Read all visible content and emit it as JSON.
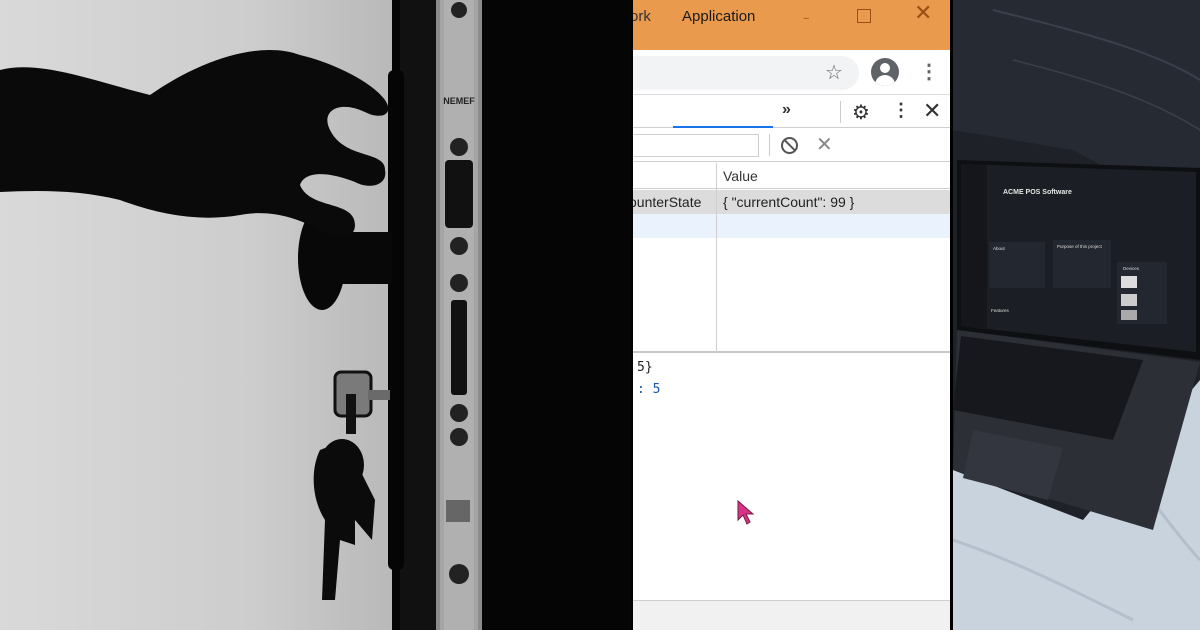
{
  "door_photo": {
    "lock_brand": "NEMEF"
  },
  "window": {
    "controls": {
      "minimize": "‒",
      "maximize": "",
      "close": "✕"
    }
  },
  "browser": {
    "star_icon": "☆",
    "menu_icon": "⋮"
  },
  "devtools": {
    "tabs": [
      {
        "label": "ork",
        "active": false
      },
      {
        "label": "Application",
        "active": true
      }
    ],
    "more_tabs": "»",
    "settings_icon": "⚙",
    "menu_icon": "⋮",
    "close_icon": "✕",
    "filter": {
      "value": ""
    },
    "delete_icon": "✕",
    "table": {
      "headers": {
        "key": "",
        "value": "Value"
      },
      "rows": [
        {
          "key": "ounterState",
          "value": "{ \"currentCount\": 99 }",
          "selected": true
        }
      ]
    },
    "preview": {
      "line1": " 5}",
      "line2": ": 5"
    }
  },
  "laptop_screen": {
    "app_title": "ACME POS Software",
    "cards": [
      "About",
      "Purpose of this project"
    ],
    "side_panel_title": "Devices",
    "section_label": "Features"
  },
  "colors": {
    "titlebar": "#e99a4c",
    "tab_accent": "#1a73e8",
    "selected_row": "#dcdcdc",
    "cursor": "#d63384"
  }
}
